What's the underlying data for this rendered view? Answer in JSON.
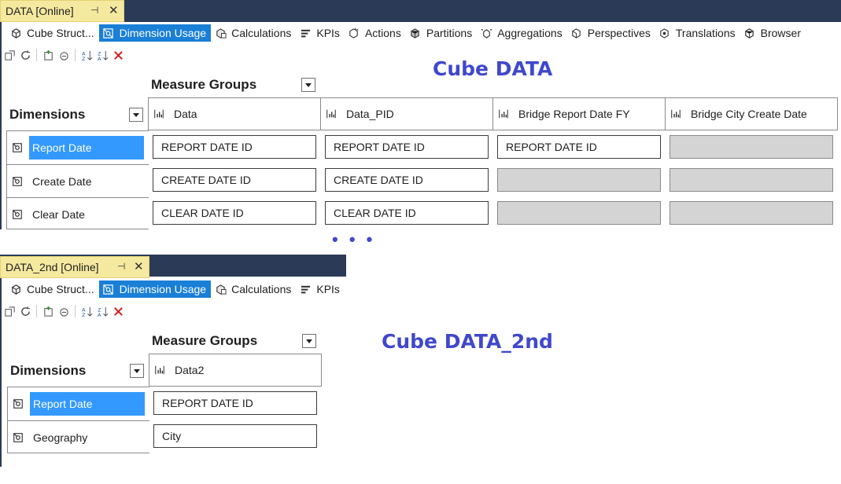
{
  "panel1": {
    "tab_title": "DATA [Online]",
    "designer_tabs": [
      {
        "label": "Cube Struct...",
        "icon": "cube-structure-icon",
        "active": false
      },
      {
        "label": "Dimension Usage",
        "icon": "dimension-usage-icon",
        "active": true
      },
      {
        "label": "Calculations",
        "icon": "calculations-icon",
        "active": false
      },
      {
        "label": "KPIs",
        "icon": "kpis-icon",
        "active": false
      },
      {
        "label": "Actions",
        "icon": "actions-icon",
        "active": false
      },
      {
        "label": "Partitions",
        "icon": "partitions-icon",
        "active": false
      },
      {
        "label": "Aggregations",
        "icon": "aggregations-icon",
        "active": false
      },
      {
        "label": "Perspectives",
        "icon": "perspectives-icon",
        "active": false
      },
      {
        "label": "Translations",
        "icon": "translations-icon",
        "active": false
      },
      {
        "label": "Browser",
        "icon": "browser-icon",
        "active": false
      }
    ],
    "cube_title": "Cube DATA",
    "measure_groups_label": "Measure Groups",
    "dimensions_label": "Dimensions",
    "measure_groups": [
      "Data",
      "Data_PID",
      "Bridge Report Date FY",
      "Bridge City Create Date"
    ],
    "dimensions": [
      {
        "label": "Report Date",
        "selected": true,
        "cells": [
          "REPORT DATE ID",
          "REPORT DATE ID",
          "REPORT DATE ID",
          ""
        ]
      },
      {
        "label": "Create Date",
        "selected": false,
        "cells": [
          "CREATE DATE ID",
          "CREATE DATE ID",
          "",
          ""
        ]
      },
      {
        "label": "Clear Date",
        "selected": false,
        "cells": [
          "CLEAR DATE ID",
          "CLEAR DATE ID",
          "",
          ""
        ]
      }
    ]
  },
  "separator": "• • •",
  "panel2": {
    "tab_title": "DATA_2nd [Online]",
    "designer_tabs": [
      {
        "label": "Cube Struct...",
        "icon": "cube-structure-icon",
        "active": false
      },
      {
        "label": "Dimension Usage",
        "icon": "dimension-usage-icon",
        "active": true
      },
      {
        "label": "Calculations",
        "icon": "calculations-icon",
        "active": false
      },
      {
        "label": "KPIs",
        "icon": "kpis-icon",
        "active": false
      }
    ],
    "cube_title": "Cube DATA_2nd",
    "measure_groups_label": "Measure Groups",
    "dimensions_label": "Dimensions",
    "measure_groups": [
      "Data2"
    ],
    "dimensions": [
      {
        "label": "Report Date",
        "selected": true,
        "cells": [
          "REPORT DATE ID"
        ]
      },
      {
        "label": "Geography",
        "selected": false,
        "cells": [
          "City"
        ]
      }
    ]
  },
  "colors": {
    "accent_selected": "#3399ff",
    "active_tab": "#1a7fd6",
    "cube_title": "#3f48cc",
    "doc_tab": "#f5e9a0",
    "tab_strip": "#2b3a57",
    "empty_cell": "#d4d4d4"
  }
}
